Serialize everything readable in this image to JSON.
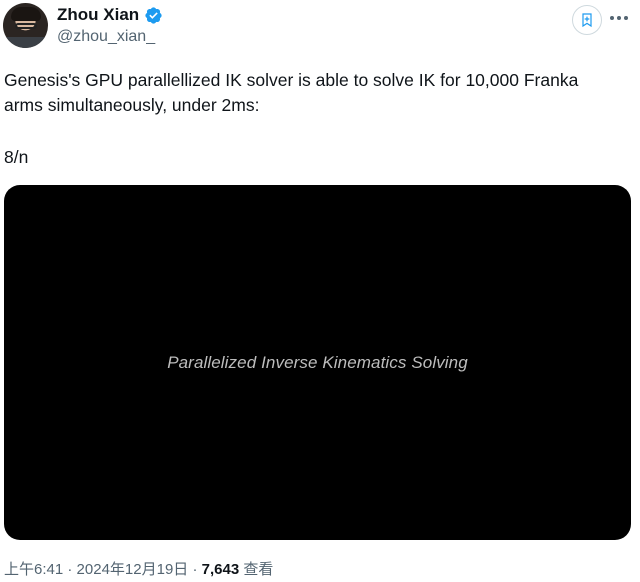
{
  "author": {
    "display_name": "Zhou Xian",
    "handle": "@zhou_xian_",
    "verified": true
  },
  "tweet": {
    "text_lines": [
      "Genesis's GPU parallellized IK solver is able to solve IK for 10,000 Franka",
      "arms simultaneously, under 2ms:"
    ],
    "thread_counter": "8/n"
  },
  "media": {
    "caption": "Parallelized Inverse Kinematics Solving",
    "background_color": "#000000"
  },
  "meta": {
    "time": "上午6:41",
    "separator": "·",
    "date": "2024年12月19日",
    "views_count": "7,643",
    "views_label": "查看"
  },
  "colors": {
    "verified_badge": "#1d9bf0",
    "secondary_text": "#536471",
    "primary_text": "#0f1419"
  },
  "icons": {
    "verified": "verified-badge-icon",
    "bookmark": "bookmark-add-icon",
    "more": "more-dots-icon"
  }
}
